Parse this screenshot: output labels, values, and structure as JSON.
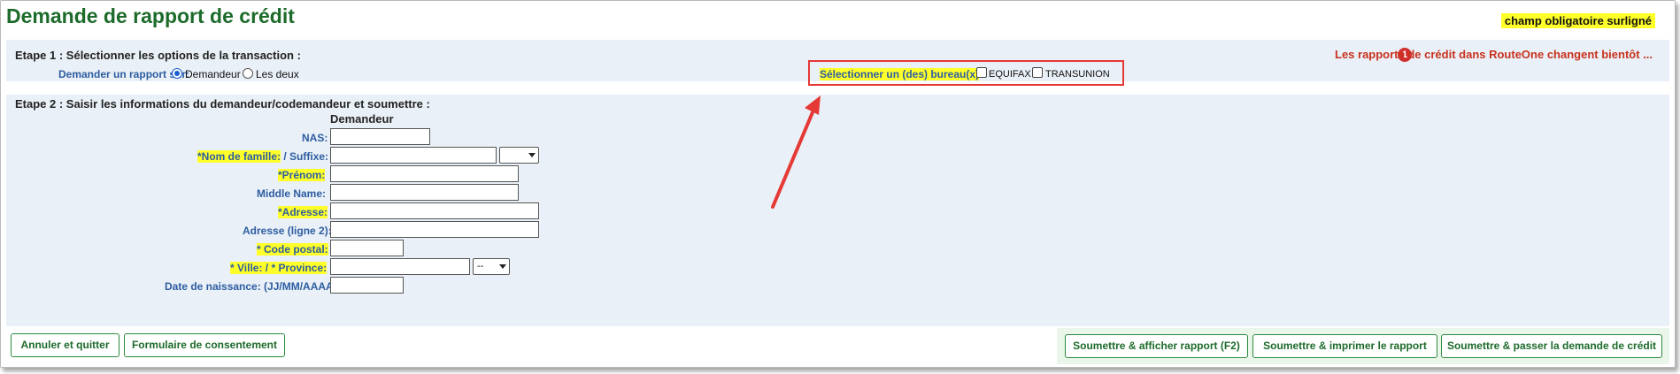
{
  "page": {
    "title": "Demande de rapport de crédit",
    "required_legend": "champ obligatoire surligné"
  },
  "step1": {
    "label": "Etape 1 : Sélectionner les options de la transaction :",
    "request_on_label": "Demander un rapport sur:",
    "options": [
      {
        "label": "Demandeur",
        "checked": true
      },
      {
        "label": "Les deux",
        "checked": false
      }
    ],
    "bureau_label": "Sélectionner un (des) bureau(x)",
    "bureaus": [
      {
        "label": "EQUIFAX",
        "checked": false
      },
      {
        "label": "TRANSUNION",
        "checked": false
      }
    ],
    "notice_badge": "1",
    "notice": "Les rapports de crédit dans RouteOne changent bientôt ...",
    "notice_color": "#c8321e"
  },
  "step2": {
    "label": "Etape 2 : Saisir les informations du demandeur/codemandeur et soumettre :",
    "column_header": "Demandeur",
    "fields": {
      "nas": {
        "label": "NAS:",
        "value": ""
      },
      "last_name": {
        "label_req": "*Nom de famille:",
        "label_rest": " / Suffixe:",
        "value": "",
        "suffix": ""
      },
      "first_name": {
        "label_req": "*Prénom:",
        "value": ""
      },
      "middle_name": {
        "label": "Middle Name:",
        "value": ""
      },
      "address": {
        "label_req": "*Adresse:",
        "value": ""
      },
      "address2": {
        "label": "Adresse (ligne 2):",
        "value": ""
      },
      "postal_code": {
        "label_req": "* Code postal:",
        "value": ""
      },
      "city_province": {
        "label_req": "* Ville: / * Province:",
        "value": "",
        "province": "--"
      },
      "birth_date": {
        "label": "Date de naissance:  (JJ/MM/AAAA)",
        "value": ""
      }
    }
  },
  "buttons": {
    "cancel": "Annuler et quitter",
    "consent": "Formulaire de consentement",
    "submit_view": "Soumettre & afficher rapport (F2)",
    "submit_print": "Soumettre & imprimer le rapport",
    "submit_pass": "Soumettre & passer la demande de crédit"
  },
  "colors": {
    "title": "#1d6b2b",
    "label": "#2d5da1",
    "highlight": "#ffff2a",
    "section_bg": "#eaf0f7",
    "annotation": "#e53935"
  }
}
